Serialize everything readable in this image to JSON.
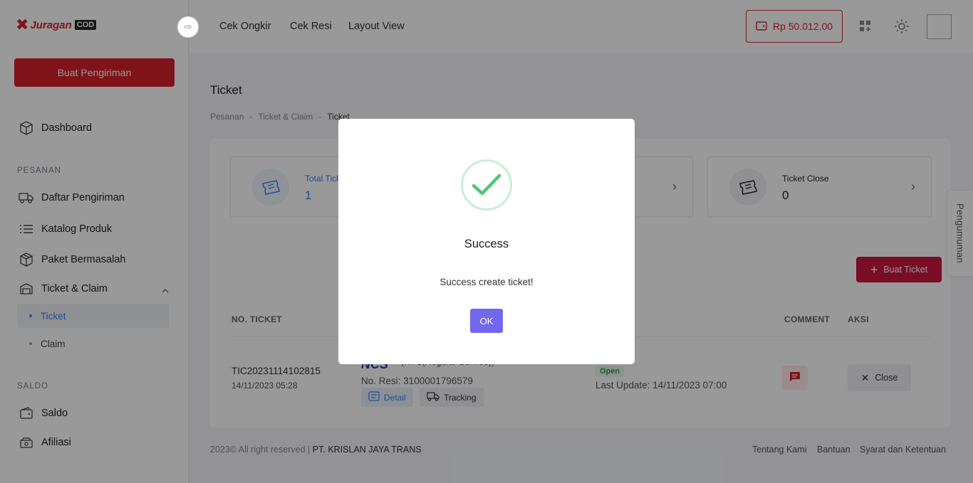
{
  "brand": {
    "name": "Juragan",
    "suffix": "COD"
  },
  "sidebar": {
    "create_button": "Buat Pengiriman",
    "dashboard": "Dashboard",
    "section_pesanan": "PESANAN",
    "items": [
      {
        "label": "Daftar Pengiriman",
        "icon": "truck-icon"
      },
      {
        "label": "Katalog Produk",
        "icon": "list-icon"
      },
      {
        "label": "Paket Bermasalah",
        "icon": "box-icon"
      },
      {
        "label": "Ticket & Claim",
        "icon": "ticket-box-icon"
      }
    ],
    "sub_items": [
      {
        "label": "Ticket",
        "active": true
      },
      {
        "label": "Claim",
        "active": false
      }
    ],
    "section_saldo": "SALDO",
    "saldo_items": [
      {
        "label": "Saldo",
        "icon": "wallet-icon"
      },
      {
        "label": "Afiliasi",
        "icon": "money-icon"
      }
    ]
  },
  "topbar": {
    "links": [
      "Cek Ongkir",
      "Cek Resi",
      "Layout View"
    ],
    "balance": "Rp 50.012,00"
  },
  "page": {
    "title": "Ticket",
    "breadcrumb": [
      "Pesanan",
      "Ticket & Claim",
      "Ticket"
    ]
  },
  "stats": [
    {
      "label": "Total Ticket",
      "value": "1",
      "color": "#3b82f6"
    },
    {
      "label": "Ticket Close",
      "value": "0",
      "color": "#222222"
    }
  ],
  "buat_ticket": "Buat Ticket",
  "table": {
    "headers": {
      "no_ticket": "NO. TICKET",
      "comment": "COMMENT",
      "aksi": "AKSI"
    },
    "row": {
      "ticket_no": "TIC20231114102815",
      "date": "14/11/2023 05:28",
      "courier": "NCS",
      "service": "(RYS(Regular Service))",
      "resi": "No. Resi: 3100001796579",
      "detail": "Detail",
      "tracking": "Tracking",
      "status": "Open",
      "last_update": "Last Update: 14/11/2023 07:00",
      "close": "Close"
    }
  },
  "footer": {
    "copyright": "2023© All right reserved |",
    "company": "PT. KRISLAN JAYA TRANS",
    "links": [
      "Tentang Kami",
      "Bantuan",
      "Syarat dan Ketentuan"
    ]
  },
  "side_tab": "Pengumuman",
  "modal": {
    "title": "Success",
    "message": "Success create ticket!",
    "ok": "OK"
  },
  "colors": {
    "brand_red": "#d5202b",
    "success_green": "#4cc77a",
    "ok_purple": "#7367f0"
  }
}
